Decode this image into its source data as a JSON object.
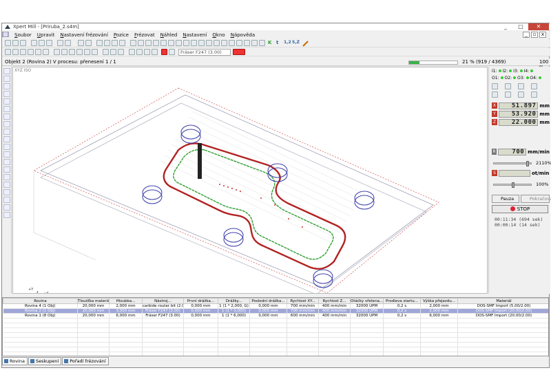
{
  "window": {
    "title": "Xpert Mill - [Priruba_2.s4m]",
    "controls": [
      "_",
      "□",
      "✕"
    ],
    "mdi_controls": [
      "_",
      "▫",
      "x"
    ]
  },
  "menu": [
    "Soubor",
    "Upravit",
    "Nastavení frézování",
    "Pozice",
    "Frézovat",
    "Náhled",
    "Nastavení",
    "Okno",
    "Nápověda"
  ],
  "toolbar": {
    "tool_combo": "Fráser F247 (3.00)",
    "k_label": "K",
    "t_label": "t",
    "n12_label": "1,2",
    "sz_label": "S,Z"
  },
  "status": {
    "object_label": "Objekt 2 (Rovina 2) V procesu: přenesení 1 / 1",
    "progress_text": "21 % (919 / 4369)",
    "progress": 0.21,
    "zoom_text": "100 %"
  },
  "viewport": {
    "view_label": "XYZ ISO",
    "axis_labels": [
      "+Y",
      "+X",
      "+Z"
    ]
  },
  "right_panel": {
    "inputs": [
      {
        "label": "I1:",
        "on": true
      },
      {
        "label": "I2:",
        "on": true
      },
      {
        "label": "I3:",
        "on": true
      },
      {
        "label": "I4:",
        "on": true
      }
    ],
    "outputs": [
      {
        "label": "O1:",
        "on": true
      },
      {
        "label": "O2:",
        "on": true
      },
      {
        "label": "O3:",
        "on": true
      },
      {
        "label": "O4:",
        "on": true
      }
    ],
    "axes": [
      {
        "axis": "X",
        "value": "51.897",
        "unit": "mm"
      },
      {
        "axis": "Y",
        "value": "53.920",
        "unit": "mm"
      },
      {
        "axis": "Z",
        "value": "22.000",
        "unit": "mm"
      }
    ],
    "feed": {
      "axis": "R",
      "value": "700",
      "unit": "mm/min",
      "percent": "2110%",
      "level": 0.9
    },
    "spindle": {
      "axis": "S",
      "value": "",
      "unit": "ot/min",
      "percent": "100%",
      "level": 0.5
    },
    "pause_label": "Pauza",
    "resume_label": "Pokračovat",
    "stop_label": "STOP",
    "time_elapsed": "00:11:34 (694 sek)",
    "time_remaining": "00:00:14 (14 sek)"
  },
  "table": {
    "columns": [
      "Rovina",
      "Tloušťka materiálu...",
      "Hloubka...",
      "Nástroj...",
      "První drážka...",
      "Drážky...",
      "Poslední drážka...",
      "Rychlost XY...",
      "Rychlost Z...",
      "Otáčky vřetena...",
      "Prodleva startu...",
      "Výška přejezdu...",
      "Materiál"
    ],
    "rows": [
      [
        "Rovina 4 (1 Obj)",
        "20,000 mm",
        "2,000 mm",
        "carbide router bit (2.00)",
        "0,000 mm",
        "1 (1 * 2,000, G)",
        "0,000 mm",
        "700 mm/min",
        "400 mm/min",
        "32000 UPM",
        "0,2 s",
        "2,000 mm",
        "DOS-SMF Import (5.00/2.00)"
      ],
      [
        "Rovina 2 (1 Obj)",
        "20,000 mm",
        "3,000 mm",
        "Fráser F247 (3.00)",
        "0,000 mm",
        "1 (1 * 3,000)",
        "0,000 mm",
        "700 mm/min",
        "400 mm/min",
        "32000 UPM",
        "0,2 s",
        "2,000 mm",
        "DOS-SMF Import (20.00/2.00)"
      ],
      [
        "Rovina 1 (8 Obj)",
        "20,000 mm",
        "6,000 mm",
        "Fráser F247 (3.00)",
        "0,000 mm",
        "1 (1 * 6,000)",
        "0,000 mm",
        "600 mm/min",
        "400 mm/min",
        "32000 UPM",
        "0,2 s",
        "6,000 mm",
        "DOS-SMF Import (20.00/2.00)"
      ]
    ],
    "selected_row": 1
  },
  "tabs": [
    "Rovina",
    "Seskupení",
    "Pořadí frézování"
  ],
  "colors": {
    "selection": "#9fa7d8",
    "progress": "#3bb24a",
    "toolpath_red": "#b22222",
    "toolpath_green": "#2e9e2e",
    "hole_blue": "#3a3aa8"
  }
}
